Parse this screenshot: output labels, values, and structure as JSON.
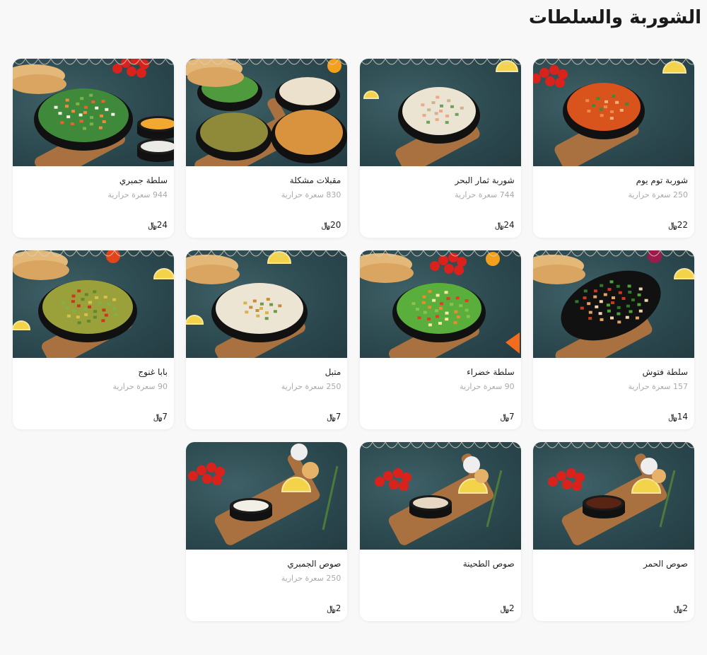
{
  "section": {
    "title": "الشوربة والسلطات"
  },
  "currency_symbol": "﷼",
  "items": [
    {
      "name": "شوربة توم يوم",
      "calories": "250",
      "calories_unit": "سعرة حرارية",
      "price": "22",
      "dish": "tom-yum-soup",
      "icon": "tom-yum-dish-icon"
    },
    {
      "name": "شوربة ثمار البحر",
      "calories": "744",
      "calories_unit": "سعرة حرارية",
      "price": "24",
      "dish": "seafood-soup",
      "icon": "seafood-soup-dish-icon"
    },
    {
      "name": "مقبلات مشكلة",
      "calories": "830",
      "calories_unit": "سعرة حرارية",
      "price": "20",
      "dish": "mixed-appetizers",
      "icon": "mixed-appetizers-dish-icon"
    },
    {
      "name": "سلطة جمبري",
      "calories": "944",
      "calories_unit": "سعرة حرارية",
      "price": "24",
      "dish": "shrimp-salad",
      "icon": "shrimp-salad-dish-icon"
    },
    {
      "name": "سلطة فتوش",
      "calories": "157",
      "calories_unit": "سعرة حرارية",
      "price": "14",
      "dish": "fattoush",
      "icon": "fattoush-dish-icon"
    },
    {
      "name": "سلطة خضراء",
      "calories": "90",
      "calories_unit": "سعرة حرارية",
      "price": "7",
      "dish": "green-salad",
      "icon": "green-salad-dish-icon"
    },
    {
      "name": "متبل",
      "calories": "250",
      "calories_unit": "سعرة حرارية",
      "price": "7",
      "dish": "mutabal",
      "icon": "mutabal-dish-icon"
    },
    {
      "name": "بابا غنوج",
      "calories": "90",
      "calories_unit": "سعرة حرارية",
      "price": "7",
      "dish": "baba-ghanoush",
      "icon": "baba-ghanoush-dish-icon"
    },
    {
      "name": "صوص الحمر",
      "calories": "",
      "calories_unit": "",
      "price": "2",
      "dish": "red-sauce",
      "icon": "red-sauce-dish-icon"
    },
    {
      "name": "صوص الطحينة",
      "calories": "",
      "calories_unit": "",
      "price": "2",
      "dish": "tahini-sauce",
      "icon": "tahini-sauce-dish-icon"
    },
    {
      "name": "صوص الجمبري",
      "calories": "250",
      "calories_unit": "سعرة حرارية",
      "price": "2",
      "dish": "shrimp-sauce",
      "icon": "shrimp-sauce-dish-icon"
    }
  ],
  "colors": {
    "background": "#f8f8f8",
    "card": "#ffffff",
    "photo_backdrop": "#2c4a50",
    "muted_text": "#a9a9a9",
    "primary_text": "#1d1d1d"
  }
}
